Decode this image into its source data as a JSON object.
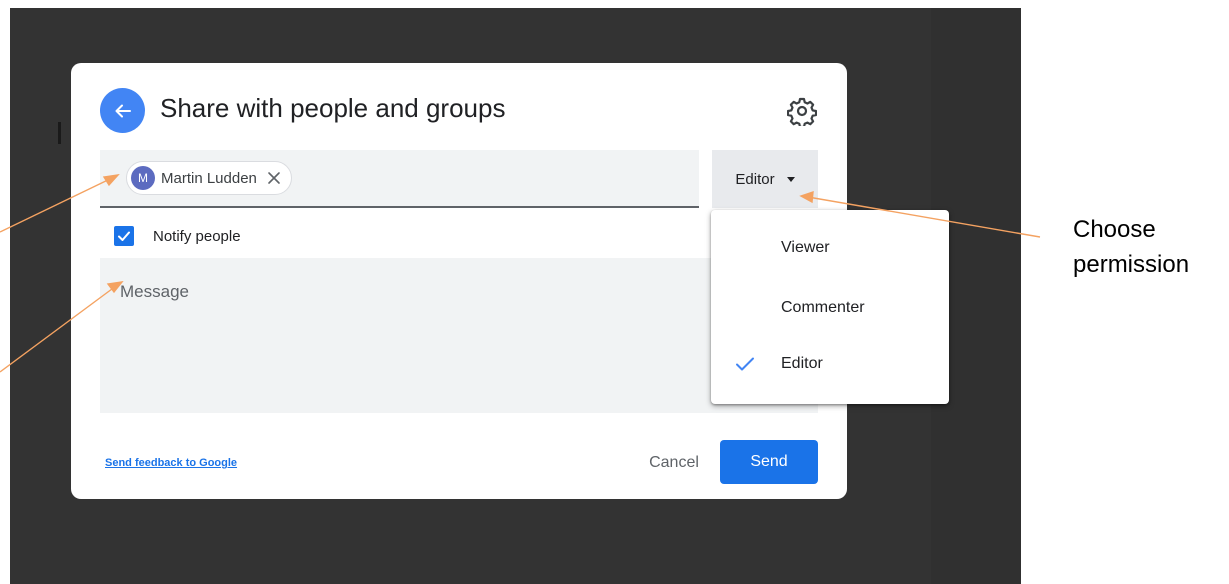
{
  "dialog": {
    "title": "Share with people and groups",
    "recipient": {
      "avatar_initial": "M",
      "name": "Martin Ludden"
    },
    "permission_button_label": "Editor",
    "notify_label": "Notify people",
    "notify_checked": true,
    "message_placeholder": "Message",
    "feedback_link": "Send feedback to Google",
    "cancel_label": "Cancel",
    "send_label": "Send"
  },
  "permission_menu": {
    "items": [
      {
        "label": "Viewer",
        "selected": false
      },
      {
        "label": "Commenter",
        "selected": false
      },
      {
        "label": "Editor",
        "selected": true
      }
    ]
  },
  "annotation": {
    "callout_line1": "Choose",
    "callout_line2": "permission",
    "arrow_color": "#f4a261"
  },
  "colors": {
    "accent": "#1a73e8",
    "back_button": "#4285f4",
    "avatar": "#5c6bc0",
    "backdrop": "#333333"
  },
  "icons": {
    "back": "arrow-left-icon",
    "settings": "gear-icon",
    "remove_chip": "close-icon",
    "dropdown": "caret-down-icon",
    "checkbox": "checkmark-icon"
  }
}
